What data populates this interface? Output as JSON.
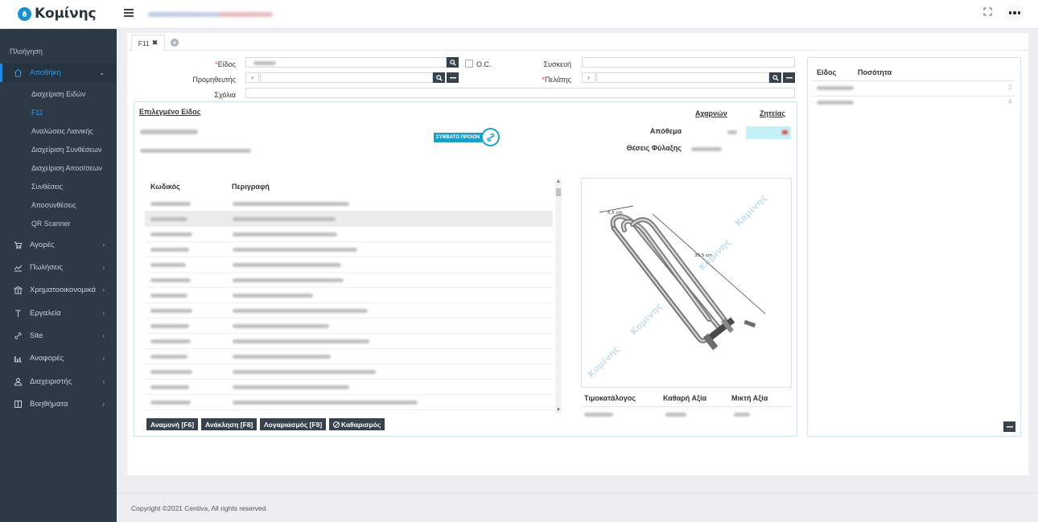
{
  "app": {
    "logo_text": "Κομίνης",
    "brand_color": "#1a8fd1"
  },
  "topbar": {
    "menu_icon": "hamburger-icon",
    "fullscreen_icon": "expand-icon",
    "more_icon": "more-dots-icon"
  },
  "sidebar": {
    "heading": "Πλοήγηση",
    "active_item": {
      "label": "Αποθήκη",
      "icon": "home-icon"
    },
    "subitems": [
      {
        "label": "Διαχείριση Ειδών"
      },
      {
        "label": "F11",
        "active": true
      },
      {
        "label": "Αναλώσεις Λιανικής"
      },
      {
        "label": "Διαχείριση Συνθέσεων"
      },
      {
        "label": "Διαχείριση Αποσ/σεων"
      },
      {
        "label": "Συνθέσεις"
      },
      {
        "label": "Αποσυνθέσεις"
      },
      {
        "label": "QR Scanner"
      }
    ],
    "items": [
      {
        "label": "Αγορές",
        "icon": "cart-icon"
      },
      {
        "label": "Πωλήσεις",
        "icon": "trend-icon"
      },
      {
        "label": "Χρηματοοικονομικά",
        "icon": "bank-icon"
      },
      {
        "label": "Εργαλεία",
        "icon": "tools-icon"
      },
      {
        "label": "Site",
        "icon": "link-icon"
      },
      {
        "label": "Αναφορές",
        "icon": "bar-chart-icon"
      },
      {
        "label": "Διαχειριστής",
        "icon": "user-icon"
      },
      {
        "label": "Βοηθήματα",
        "icon": "book-icon"
      }
    ]
  },
  "tabs": [
    {
      "label": "F11",
      "close": "✖"
    }
  ],
  "form": {
    "item_label": "Είδος",
    "oc_label": "O.C.",
    "device_label": "Συσκευή",
    "supplier_label": "Προμηθευτής",
    "customer_label": "Πελάτης",
    "comments_label": "Σχόλια",
    "arrow": "›",
    "required_mark": "*"
  },
  "selected_item": {
    "title": "Επιλεγμένο Είδος",
    "colorless_link": "Αχαρνών",
    "requests_link": "Ζητείας",
    "stock_label": "Απόθεμα",
    "storage_label": "Θέσεις Φύλαξης",
    "badge_text": "ΣΥΜΒΑΤΟ ΠΡΟΙΟΝ"
  },
  "table": {
    "headers": [
      "Κωδικός",
      "Περιγραφή"
    ],
    "row_count": 14
  },
  "actions": [
    {
      "label": "Αναμονή [F6]"
    },
    {
      "label": "Ανάκληση [F8]"
    },
    {
      "label": "Λογαριασμός [F9]"
    },
    {
      "label": "Καθαρισμός",
      "icon": "clear-icon"
    }
  ],
  "image": {
    "dim1": "6,5 cm",
    "dim2": "30,5 cm",
    "watermark": "Κομίνης"
  },
  "price_table": {
    "headers": [
      "Τιμοκατάλογος",
      "Καθαρή Αξία",
      "Μικτή Αξία"
    ]
  },
  "cart": {
    "headers": [
      "Είδος",
      "Ποσότητα"
    ],
    "qty": [
      "2",
      "4"
    ]
  },
  "footer": {
    "text": "Copyright ©2021 Centiva, All rights reserved."
  }
}
